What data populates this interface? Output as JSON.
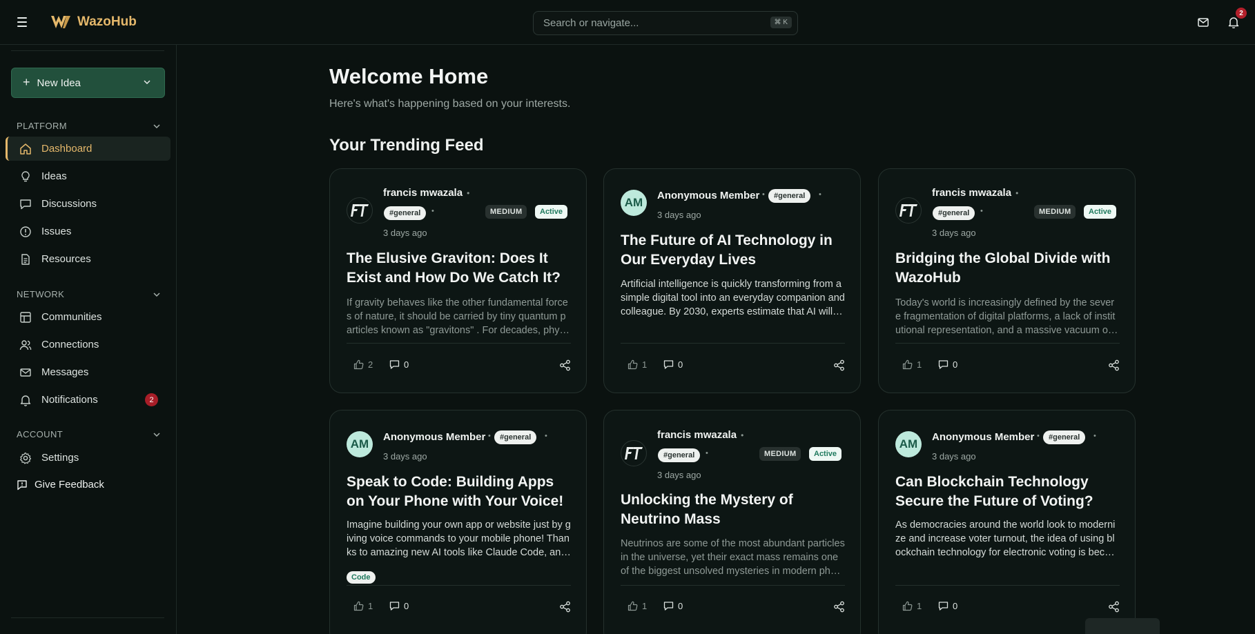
{
  "app": {
    "name": "WazoHub"
  },
  "header": {
    "search": {
      "placeholder": "Search or navigate...",
      "shortcut": "⌘ K"
    },
    "notifications_count": "2"
  },
  "sidebar": {
    "new_idea_label": "New Idea",
    "sections": {
      "platform": "PLATFORM",
      "network": "NETWORK",
      "account": "ACCOUNT"
    },
    "platform_items": [
      "Dashboard",
      "Ideas",
      "Discussions",
      "Issues",
      "Resources"
    ],
    "network_items": [
      "Communities",
      "Connections",
      "Messages",
      "Notifications"
    ],
    "notifications_badge": "2",
    "account_items": [
      "Settings"
    ],
    "feedback_label": "Give Feedback",
    "active_item": "Dashboard"
  },
  "main": {
    "welcome": "Welcome Home",
    "subtitle": "Here's what's happening based on your interests.",
    "feed_title": "Your Trending Feed"
  },
  "cards": [
    {
      "author": "francis mwazala",
      "tag": "#general",
      "level": "MEDIUM",
      "status": "Active",
      "time": "3 days ago",
      "title": "The Elusive Graviton: Does It Exist and How Do We Catch It?",
      "excerpt": "If gravity behaves like the other fundamental forces of nature, it should be carried by tiny quantum particles known as \"gravitons\" . For decades, physicists have been searching for them.",
      "likes": "2",
      "comments": "0"
    },
    {
      "author": "Anonymous Member",
      "initials": "AM",
      "tag": "#general",
      "time": "3 days ago",
      "title": "The Future of AI Technology in Our Everyday Lives",
      "excerpt": "Artificial intelligence is quickly transforming from a simple digital tool into an everyday companion and colleague. By 2030, experts estimate that AI will be embedded in daily life.",
      "likes": "1",
      "comments": "0"
    },
    {
      "author": "francis mwazala",
      "tag": "#general",
      "level": "MEDIUM",
      "status": "Active",
      "time": "3 days ago",
      "title": "Bridging the Global Divide with WazoHub",
      "excerpt": "Today's world is increasingly defined by the severe fragmentation of digital platforms, a lack of institutional representation, and a massive vacuum of trust.",
      "likes": "1",
      "comments": "0"
    },
    {
      "author": "Anonymous Member",
      "initials": "AM",
      "tag": "#general",
      "time": "3 days ago",
      "title": "Speak to Code: Building Apps on Your Phone with Your Voice!",
      "excerpt": "Imagine building your own app or website just by giving voice commands to your mobile phone! Thanks to amazing new AI tools like Claude Code, anyone can build.",
      "chip": "Code",
      "likes": "1",
      "comments": "0"
    },
    {
      "author": "francis mwazala",
      "tag": "#general",
      "level": "MEDIUM",
      "status": "Active",
      "time": "3 days ago",
      "title": "Unlocking the Mystery of Neutrino Mass",
      "excerpt": "Neutrinos are some of the most abundant particles in the universe, yet their exact mass remains one of the biggest unsolved mysteries in modern physics.",
      "likes": "1",
      "comments": "0"
    },
    {
      "author": "Anonymous Member",
      "initials": "AM",
      "tag": "#general",
      "time": "3 days ago",
      "title": "Can Blockchain Technology Secure the Future of Voting?",
      "excerpt": "As democracies around the world look to modernize and increase voter turnout, the idea of using blockchain technology for electronic voting is becoming popular.",
      "likes": "1",
      "comments": "0"
    }
  ]
}
